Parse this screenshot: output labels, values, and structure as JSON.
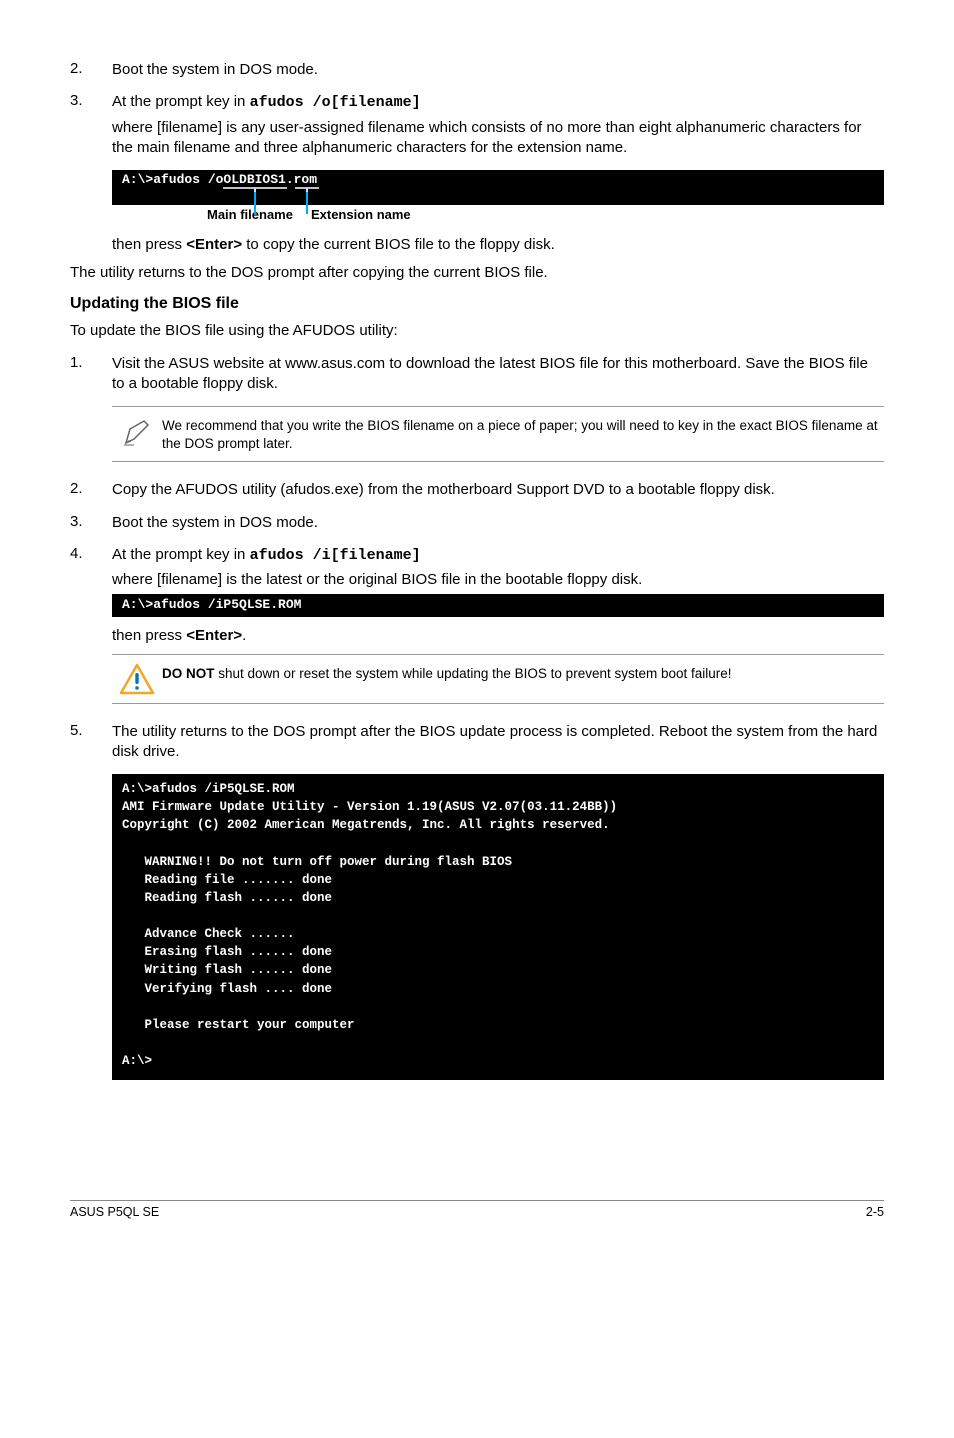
{
  "step2": {
    "num": "2.",
    "text": "Boot the system in DOS mode."
  },
  "step3": {
    "num": "3.",
    "line1_a": "At the prompt key in ",
    "line1_cmd": "afudos /o[filename]",
    "line2": "where [filename] is any user-assigned filename which consists of no more than eight alphanumeric characters for the main filename and three alphanumeric characters for the extension name."
  },
  "cmd1": "A:\\>afudos /oOLDBIOS1.rom",
  "fn_labels": {
    "main": "Main filename",
    "ext": "Extension name"
  },
  "then1_a": "then press ",
  "then1_b": "<Enter>",
  "then1_c": " to copy the current BIOS file to the floppy disk.",
  "utility_returns": "The utility returns to the DOS prompt after copying the current BIOS file.",
  "section_title": "Updating the BIOS file",
  "update_intro": "To update the BIOS file using the AFUDOS utility:",
  "u1": {
    "num": "1.",
    "text": "Visit the ASUS website at www.asus.com to download the latest BIOS file for this motherboard. Save the BIOS file to a bootable floppy disk."
  },
  "note1": "We recommend that you write the BIOS filename on a piece of paper; you will need to key in the exact BIOS filename at the DOS prompt later.",
  "u2": {
    "num": "2.",
    "text": "Copy the AFUDOS utility (afudos.exe) from the motherboard Support DVD to a bootable floppy disk."
  },
  "u3": {
    "num": "3.",
    "text": "Boot the system in DOS mode."
  },
  "u4": {
    "num": "4.",
    "line1_a": "At the prompt key in ",
    "line1_cmd": "afudos /i[filename]",
    "line2": "where [filename] is the latest or the original BIOS file in the bootable floppy disk."
  },
  "cmd2": "A:\\>afudos /iP5QLSE.ROM",
  "then2_a": "then press ",
  "then2_b": "<Enter>",
  "then2_c": ".",
  "warn_a": "DO NOT",
  "warn_b": " shut down or reset the system while updating the BIOS to prevent system boot failure!",
  "u5": {
    "num": "5.",
    "text": "The utility returns to the DOS prompt after the BIOS update process is completed. Reboot the system from the hard disk drive."
  },
  "terminal": "A:\\>afudos /iP5QLSE.ROM\nAMI Firmware Update Utility - Version 1.19(ASUS V2.07(03.11.24BB))\nCopyright (C) 2002 American Megatrends, Inc. All rights reserved.\n\n   WARNING!! Do not turn off power during flash BIOS\n   Reading file ....... done\n   Reading flash ...... done\n\n   Advance Check ......\n   Erasing flash ...... done\n   Writing flash ...... done\n   Verifying flash .... done\n\n   Please restart your computer\n\nA:\\>",
  "footer": {
    "left": "ASUS P5QL SE",
    "right": "2-5"
  }
}
